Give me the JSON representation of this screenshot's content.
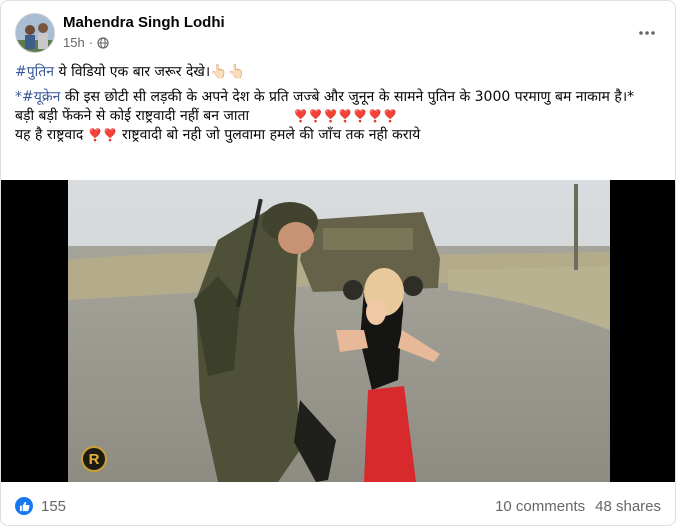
{
  "post": {
    "author": "Mahendra Singh Lodhi",
    "time": "15h",
    "dot": "·",
    "text": {
      "line1_tag": "#पुतिन",
      "line1": " ये विडियो एक बार जरूर देखे।👆🏻👆🏻",
      "line2_star": "*",
      "line2_tag": "#यूक्रेन",
      "line2": " की इस छोटी सी लड़की के अपने देश के प्रति जज्बे और जुनून के सामने पुतिन के 3000 परमाणु बम नाकाम है।*",
      "line3": "बड़ी बड़ी फेंकने से कोई राष्ट्रवादी नहीं बन जाता",
      "line3_hearts": "❣️❣️❣️❣️❣️❣️❣️",
      "line4_a": "यह है राष्ट्रवाद ",
      "line4_hearts": "❣️❣️",
      "line4_b": " राष्ट्रवादी बो नही जो पुलवामा हमले की जाँच तक नही कराये"
    },
    "video_logo": "R"
  },
  "footer": {
    "reaction_count": "155",
    "comments": "10 comments",
    "shares": "48 shares"
  },
  "colors": {
    "link": "#385898",
    "secondary_text": "#65676b",
    "like_blue": "#1877f2",
    "heart_red": "#e41e3f"
  },
  "icons": [
    "globe-icon",
    "more-options-icon",
    "like-reaction-icon",
    "channel-logo-icon"
  ]
}
